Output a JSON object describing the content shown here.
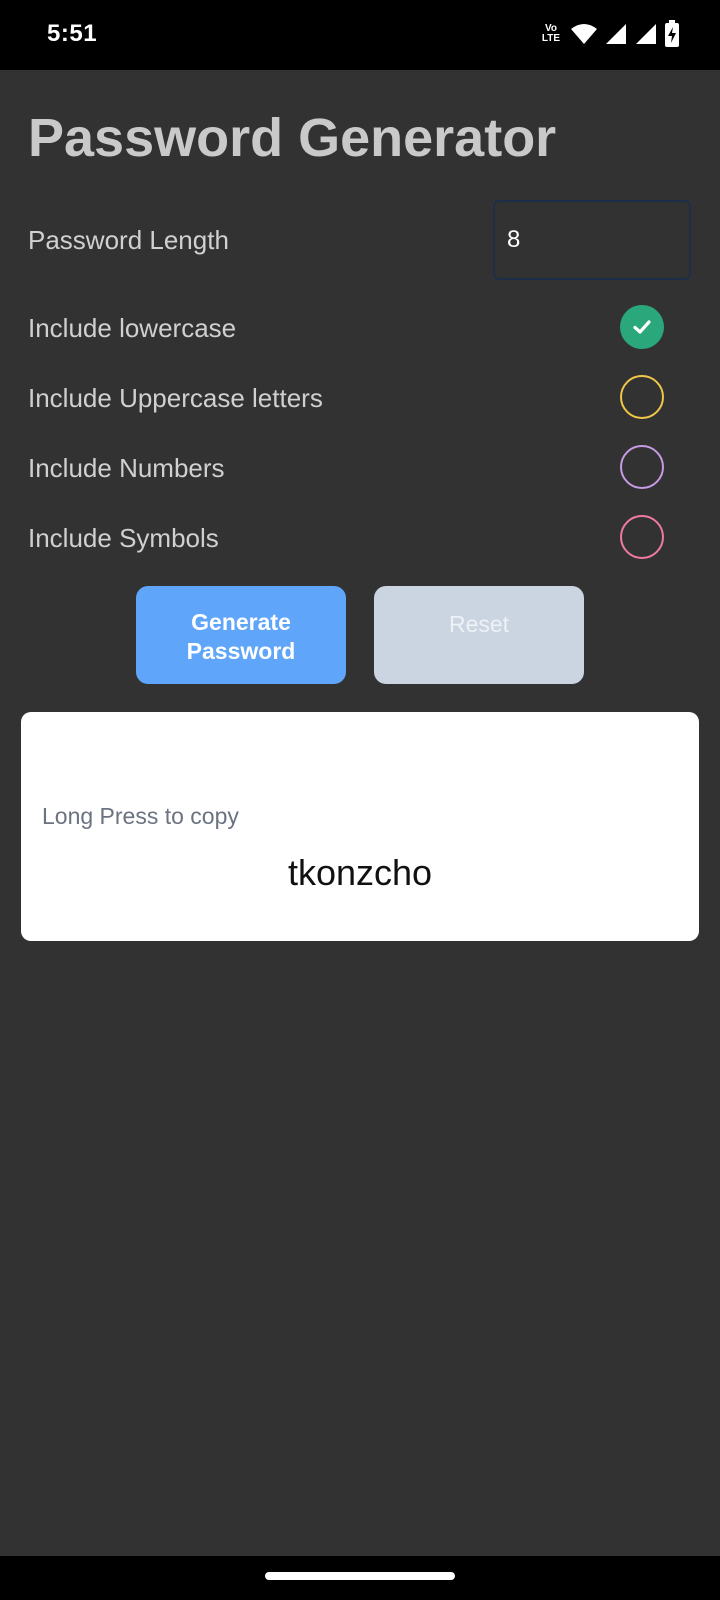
{
  "status_bar": {
    "time": "5:51",
    "network_label_top": "Vo",
    "network_label_bottom": "LTE",
    "icons": [
      "wifi-icon",
      "signal-icon",
      "signal-icon",
      "battery-charging-icon"
    ]
  },
  "app": {
    "title": "Password Generator"
  },
  "form": {
    "length_label": "Password Length",
    "length_value": "8",
    "options": [
      {
        "label": "Include lowercase",
        "checked": true,
        "color": "#2aa87c"
      },
      {
        "label": "Include Uppercase letters",
        "checked": false,
        "color": "#f0c64a"
      },
      {
        "label": "Include Numbers",
        "checked": false,
        "color": "#c59be3"
      },
      {
        "label": "Include Symbols",
        "checked": false,
        "color": "#f07aa0"
      }
    ]
  },
  "buttons": {
    "generate_line1": "Generate",
    "generate_line2": "Password",
    "reset": "Reset",
    "generate_color": "#5fa5fa",
    "reset_color": "#cbd5e1"
  },
  "result": {
    "hint": "Long Press to copy",
    "password": "tkonzcho"
  }
}
